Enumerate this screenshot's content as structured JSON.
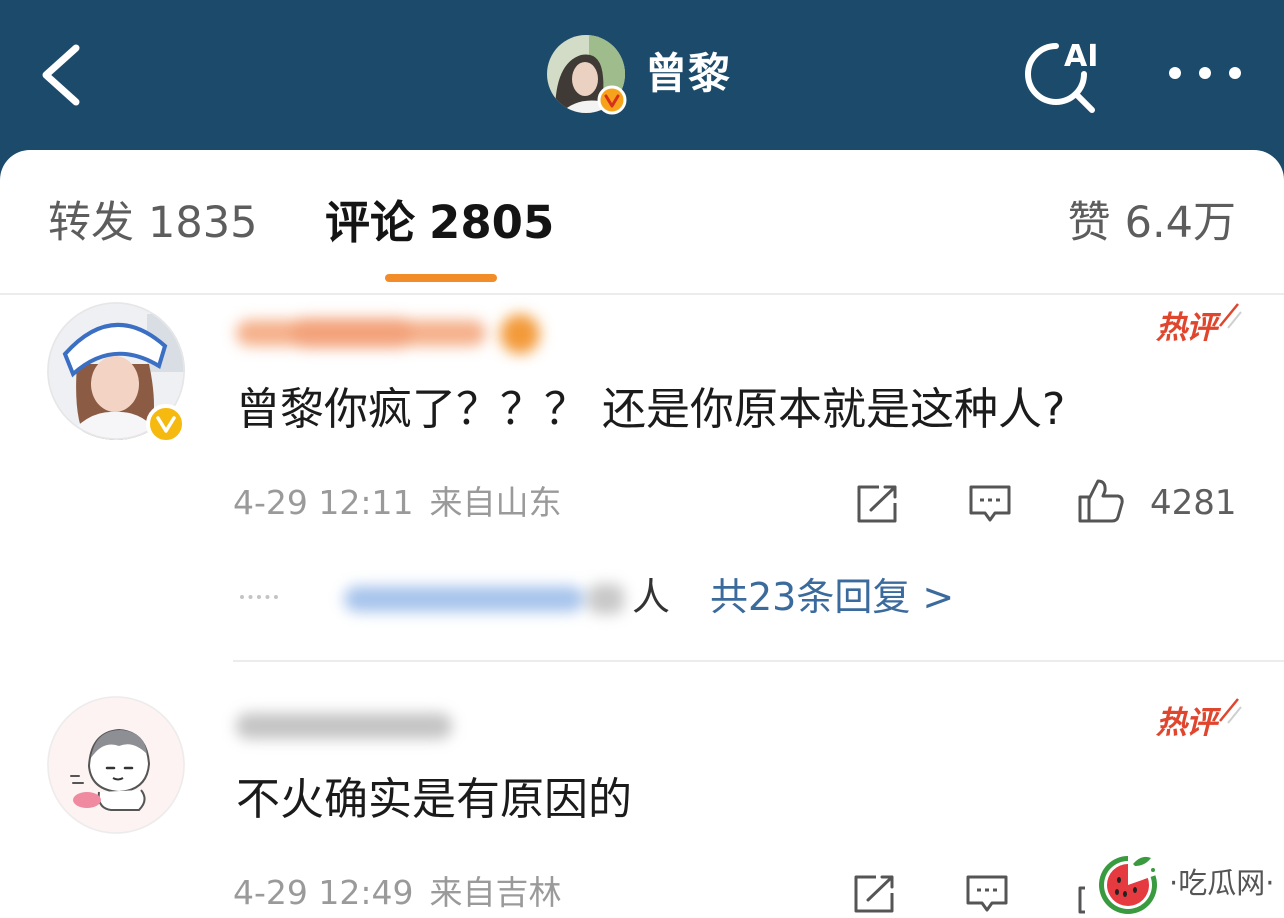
{
  "theme": {
    "header_bg": "#1c4a6a",
    "accent": "#f28c28",
    "hot": "#e0452d",
    "link": "#3b6a9c",
    "verified_orange": "#f7a21b",
    "verified_yellow": "#f5b90f",
    "watermelon_green": "#3a9a3f",
    "watermelon_red": "#e53a3f"
  },
  "header": {
    "back_icon": "chevron-left-icon",
    "title": "曾黎",
    "ai_label": "AI",
    "search_icon": "ai-search-icon",
    "more_icon": "more-dots-icon"
  },
  "tabs": [
    {
      "label": "转发",
      "count": "1835",
      "active": false
    },
    {
      "label": "评论",
      "count": "2805",
      "active": true
    },
    {
      "label": "赞",
      "count": "6.4万",
      "active": false
    }
  ],
  "comments": [
    {
      "badge": "热评",
      "text": "曾黎你疯了？？？ 还是你原本就是这种人?",
      "time": "4-29 12:11",
      "location": "来自山东",
      "likes": "4281",
      "actions": [
        "share-icon",
        "comment-icon",
        "like-icon"
      ],
      "replies": {
        "suffix": "人",
        "link": "共23条回复 >"
      }
    },
    {
      "badge": "热评",
      "text": "不火确实是有原因的",
      "time": "4-29 12:49",
      "location": "来自吉林",
      "actions": [
        "share-icon",
        "comment-icon",
        "like-icon"
      ]
    }
  ],
  "watermark": {
    "text": "·吃瓜网·",
    "icon": "watermelon-icon"
  }
}
